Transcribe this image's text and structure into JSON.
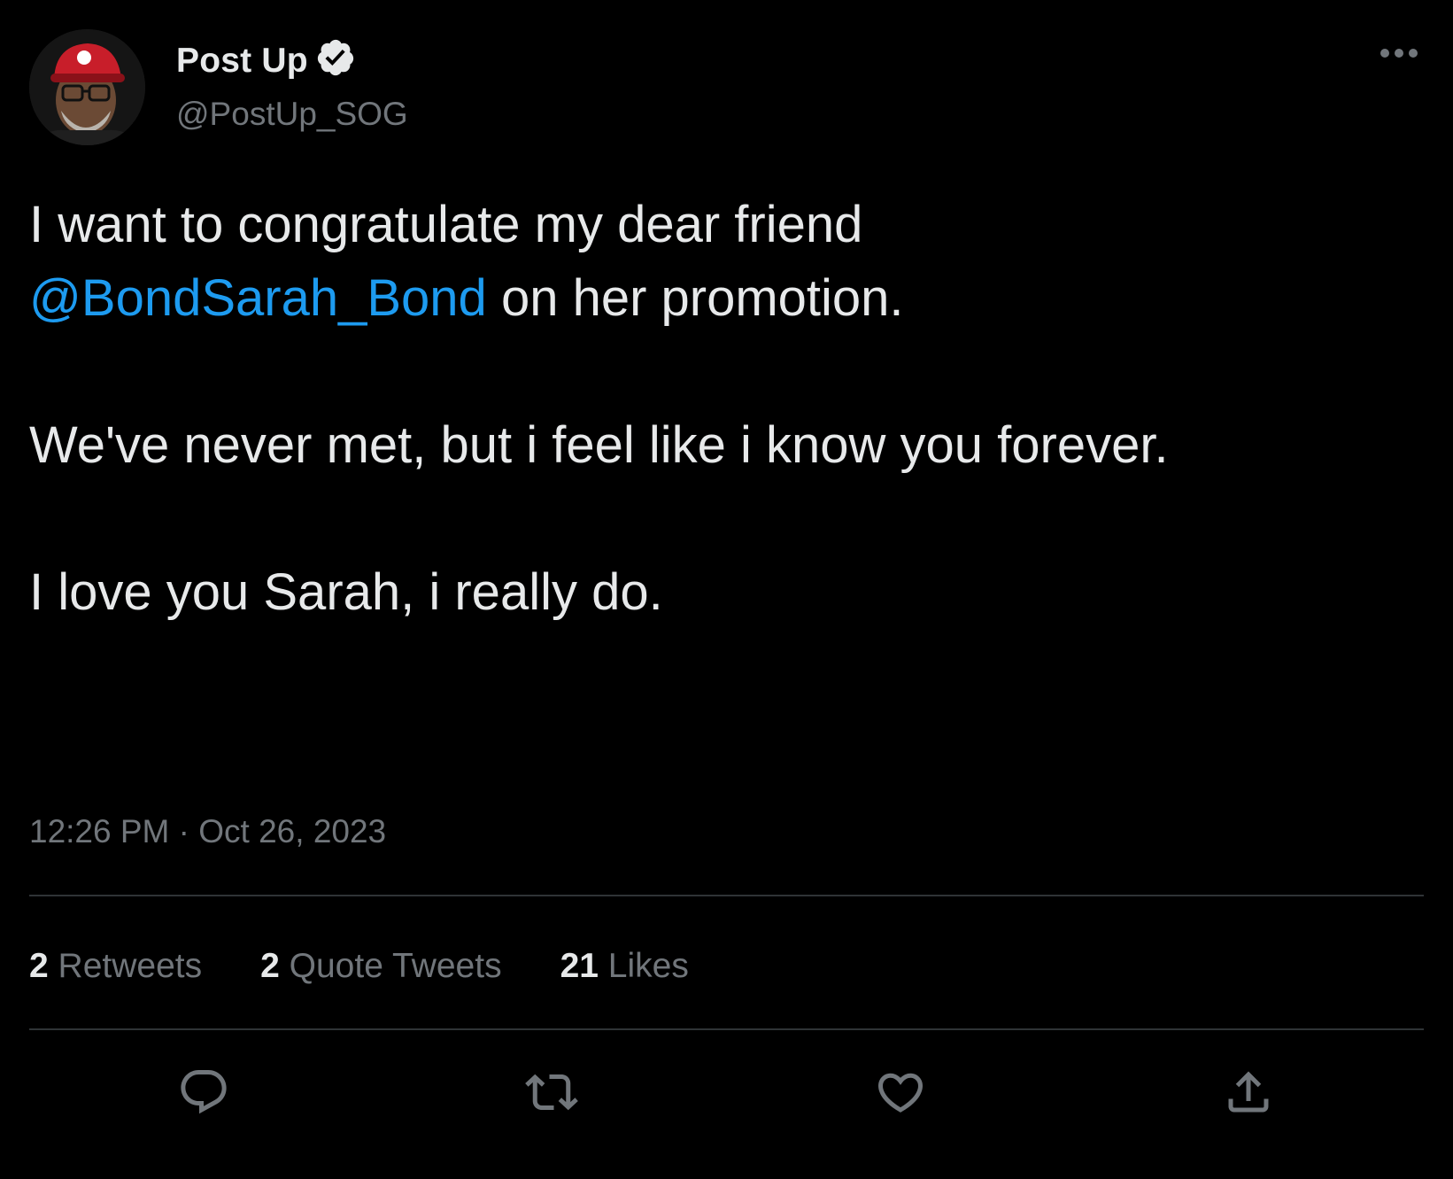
{
  "author": {
    "display_name": "Post Up",
    "handle": "@PostUp_SOG",
    "verified": true,
    "avatar_icon": "profile-photo-man-red-cap-glasses"
  },
  "tweet": {
    "line1": "I want to congratulate my dear friend",
    "mention": "@BondSarah_Bond",
    "line2_rest": " on her promotion.",
    "paragraph2": "We've never met, but i feel like i know you forever.",
    "paragraph3": "I love you Sarah, i really do."
  },
  "timestamp": {
    "time": "12:26 PM",
    "separator": " · ",
    "date": "Oct 26, 2023"
  },
  "stats": {
    "retweets_count": "2",
    "retweets_label": " Retweets",
    "quotes_count": "2",
    "quotes_label": " Quote Tweets",
    "likes_count": "21",
    "likes_label": " Likes"
  },
  "actions": [
    {
      "icon": "reply-icon"
    },
    {
      "icon": "retweet-icon"
    },
    {
      "icon": "like-icon"
    },
    {
      "icon": "share-icon"
    }
  ],
  "colors": {
    "background": "#000000",
    "text": "#e7e9ea",
    "secondary": "#71767b",
    "link": "#1d9bf0",
    "divider": "#2f3336"
  }
}
